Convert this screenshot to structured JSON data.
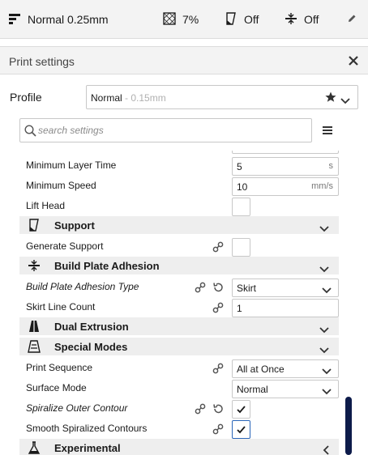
{
  "top_bar": {
    "profile": "Normal 0.25mm",
    "infill": "7%",
    "support": "Off",
    "adhesion": "Off"
  },
  "panel": {
    "title": "Print settings"
  },
  "profile": {
    "label": "Profile",
    "name": "Normal",
    "sub": " - 0.15mm"
  },
  "search": {
    "placeholder": "search settings"
  },
  "settings": {
    "min_layer_time": {
      "label": "Minimum Layer Time",
      "value": "5",
      "unit": "s"
    },
    "min_speed": {
      "label": "Minimum Speed",
      "value": "10",
      "unit": "mm/s"
    },
    "lift_head": {
      "label": "Lift Head",
      "checked": false
    },
    "support_cat": {
      "title": "Support"
    },
    "generate_support": {
      "label": "Generate Support",
      "checked": false
    },
    "adhesion_cat": {
      "title": "Build Plate Adhesion"
    },
    "adhesion_type": {
      "label": "Build Plate Adhesion Type",
      "value": "Skirt"
    },
    "skirt_line_count": {
      "label": "Skirt Line Count",
      "value": "1"
    },
    "dual_cat": {
      "title": "Dual Extrusion"
    },
    "special_cat": {
      "title": "Special Modes"
    },
    "print_sequence": {
      "label": "Print Sequence",
      "value": "All at Once"
    },
    "surface_mode": {
      "label": "Surface Mode",
      "value": "Normal"
    },
    "spiralize": {
      "label": "Spiralize Outer Contour",
      "checked": true
    },
    "smooth_spiral": {
      "label": "Smooth Spiralized Contours",
      "checked": true
    },
    "experimental_cat": {
      "title": "Experimental"
    }
  },
  "colors": {
    "accent": "#2b66b9",
    "scrollbar": "#0d1b4a",
    "category_bg": "#eeeeee"
  }
}
